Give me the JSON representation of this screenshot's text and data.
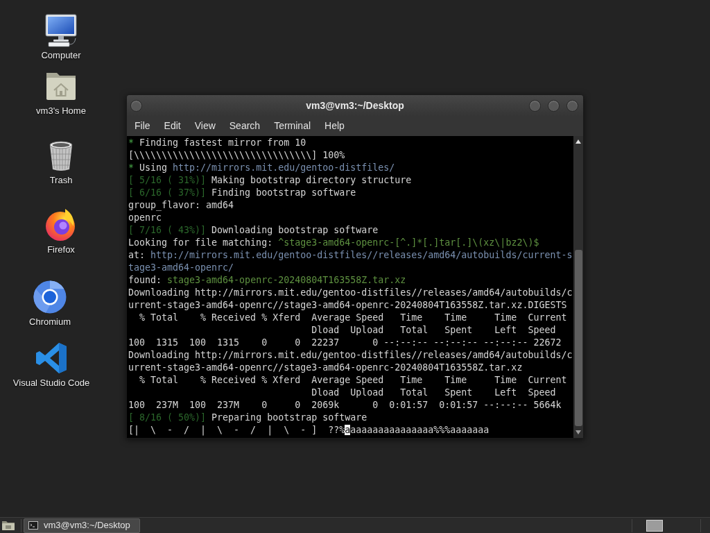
{
  "desktop_icons": [
    {
      "label": "Computer",
      "kind": "computer"
    },
    {
      "label": "vm3's Home",
      "kind": "home"
    },
    {
      "label": "Trash",
      "kind": "trash"
    },
    {
      "label": "Firefox",
      "kind": "firefox"
    },
    {
      "label": "Chromium",
      "kind": "chromium"
    },
    {
      "label": "Visual Studio Code",
      "kind": "vscode"
    }
  ],
  "terminal_window": {
    "title": "vm3@vm3:~/Desktop",
    "menu": [
      {
        "label": "File"
      },
      {
        "label": "Edit"
      },
      {
        "label": "View"
      },
      {
        "label": "Search"
      },
      {
        "label": "Terminal"
      },
      {
        "label": "Help"
      }
    ],
    "lines": [
      {
        "segments": [
          {
            "kind": "bullet",
            "text": "*"
          },
          {
            "kind": "plain",
            "text": " Finding fastest mirror from 10"
          }
        ]
      },
      {
        "segments": [
          {
            "kind": "plain",
            "text": "[\\\\\\\\\\\\\\\\\\\\\\\\\\\\\\\\\\\\\\\\\\\\\\\\\\\\\\\\\\\\\\\\] 100%"
          }
        ]
      },
      {
        "segments": [
          {
            "kind": "bullet",
            "text": "*"
          },
          {
            "kind": "plain",
            "text": " Using "
          },
          {
            "kind": "url",
            "text": "http://mirrors.mit.edu/gentoo-distfiles/"
          }
        ]
      },
      {
        "segments": [
          {
            "kind": "step",
            "text": "[ 5/16 ( 31%)]"
          },
          {
            "kind": "plain",
            "text": " Making bootstrap directory structure"
          }
        ]
      },
      {
        "segments": [
          {
            "kind": "step",
            "text": "[ 6/16 ( 37%)]"
          },
          {
            "kind": "plain",
            "text": " Finding bootstrap software"
          }
        ]
      },
      {
        "segments": [
          {
            "kind": "plain",
            "text": "group_flavor: amd64"
          }
        ]
      },
      {
        "segments": [
          {
            "kind": "plain",
            "text": "openrc"
          }
        ]
      },
      {
        "segments": [
          {
            "kind": "step",
            "text": "[ 7/16 ( 43%)]"
          },
          {
            "kind": "plain",
            "text": " Downloading bootstrap software"
          }
        ]
      },
      {
        "segments": [
          {
            "kind": "plain",
            "text": "Looking for file matching: "
          },
          {
            "kind": "match",
            "text": "^stage3-amd64-openrc-[^.]*[.]tar[.]\\(xz\\|bz2\\)$"
          }
        ]
      },
      {
        "segments": [
          {
            "kind": "plain",
            "text": "at: "
          },
          {
            "kind": "url",
            "text": "http://mirrors.mit.edu/gentoo-distfiles//releases/amd64/autobuilds/current-s"
          }
        ]
      },
      {
        "segments": [
          {
            "kind": "url",
            "text": "tage3-amd64-openrc/"
          }
        ]
      },
      {
        "segments": [
          {
            "kind": "plain",
            "text": "found: "
          },
          {
            "kind": "match",
            "text": "stage3-amd64-openrc-20240804T163558Z.tar.xz"
          }
        ]
      },
      {
        "segments": [
          {
            "kind": "plain",
            "text": "Downloading http://mirrors.mit.edu/gentoo-distfiles//releases/amd64/autobuilds/c"
          }
        ]
      },
      {
        "segments": [
          {
            "kind": "plain",
            "text": "urrent-stage3-amd64-openrc//stage3-amd64-openrc-20240804T163558Z.tar.xz.DIGESTS"
          }
        ]
      },
      {
        "segments": [
          {
            "kind": "plain",
            "text": "  % Total    % Received % Xferd  Average Speed   Time    Time     Time  Current"
          }
        ]
      },
      {
        "segments": [
          {
            "kind": "plain",
            "text": "                                 Dload  Upload   Total   Spent    Left  Speed"
          }
        ]
      },
      {
        "segments": [
          {
            "kind": "plain",
            "text": "100  1315  100  1315    0     0  22237      0 --:--:-- --:--:-- --:--:-- 22672"
          }
        ]
      },
      {
        "segments": [
          {
            "kind": "plain",
            "text": "Downloading http://mirrors.mit.edu/gentoo-distfiles//releases/amd64/autobuilds/c"
          }
        ]
      },
      {
        "segments": [
          {
            "kind": "plain",
            "text": "urrent-stage3-amd64-openrc//stage3-amd64-openrc-20240804T163558Z.tar.xz"
          }
        ]
      },
      {
        "segments": [
          {
            "kind": "plain",
            "text": "  % Total    % Received % Xferd  Average Speed   Time    Time     Time  Current"
          }
        ]
      },
      {
        "segments": [
          {
            "kind": "plain",
            "text": "                                 Dload  Upload   Total   Spent    Left  Speed"
          }
        ]
      },
      {
        "segments": [
          {
            "kind": "plain",
            "text": "100  237M  100  237M    0     0  2069k      0  0:01:57  0:01:57 --:--:-- 5664k"
          }
        ]
      },
      {
        "segments": [
          {
            "kind": "step",
            "text": "[ 8/16 ( 50%)]"
          },
          {
            "kind": "plain",
            "text": " Preparing bootstrap software"
          }
        ]
      },
      {
        "segments": [
          {
            "kind": "plain",
            "text": "[|  \\  -  /  |  \\  -  /  |  \\  - ]  ??%"
          },
          {
            "kind": "cursor",
            "text": "a"
          },
          {
            "kind": "plain",
            "text": "aaaaaaaaaaaaaaa%%%aaaaaaa"
          }
        ]
      }
    ]
  },
  "taskbar": {
    "tasks": [
      {
        "label": "vm3@vm3:~/Desktop",
        "selected": true
      }
    ]
  }
}
